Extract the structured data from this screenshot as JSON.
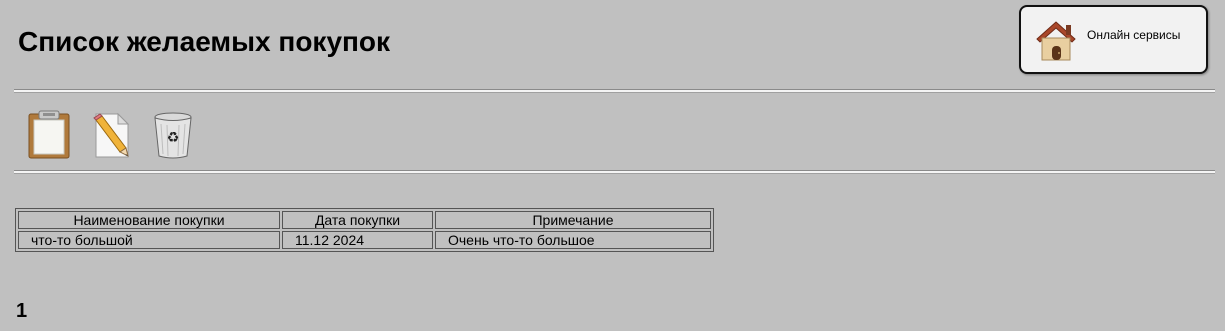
{
  "header": {
    "title": "Список желаемых покупок",
    "online_services_label": "Онлайн сервисы"
  },
  "toolbar": {
    "icons": [
      "clipboard-icon",
      "edit-pencil-icon",
      "trash-icon"
    ]
  },
  "table": {
    "columns": [
      "Наименование покупки",
      "Дата покупки",
      "Примечание"
    ],
    "rows": [
      [
        "что-то большой",
        "11.12 2024",
        "Очень что-то большое"
      ]
    ]
  },
  "pagination": {
    "current_page": "1"
  },
  "colors": {
    "background": "#c0c0c0",
    "button_background": "#f2f2f2"
  }
}
